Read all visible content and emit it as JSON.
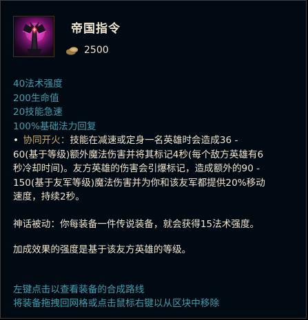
{
  "item": {
    "name": "帝国指令",
    "cost": "2500",
    "icon": "imperial-mandate-item-icon",
    "cost_icon": "gold-coins-icon"
  },
  "stats": [
    "40法术强度",
    "200生命值",
    "20技能急速",
    "100%基础法力回复"
  ],
  "passive": {
    "bullet": "•",
    "name": "协同开火：",
    "first_line": "技能在减速或定身一名英雄时会造成36 -",
    "lines": [
      "60(基于等级)额外魔法伤害并将其标记4秒(每个敌方英雄有6",
      "秒冷却时间)。友方英雄的伤害会引爆标记，造成额外的90 -",
      "150(基于友军等级)魔法伤害并为你和该友军都提供20%移动",
      "速度，持续2秒。"
    ]
  },
  "mythic_passive": "神话被动：你每装备一件传说装备，就会获得15法术强度。",
  "bonus_note": "加成效果的强度是基于该友方英雄的等级。",
  "hints": {
    "left_click": "左键点击以查看装备的合成路线",
    "right_click": "将装备拖拽回网格或点击鼠标右键以从区块中移除"
  },
  "colors": {
    "background": "#010a13",
    "text": "#f0e6d2",
    "stat_text": "#3f9fae",
    "passive_name": "#c8aa6e",
    "gold": "#c8aa6e"
  }
}
